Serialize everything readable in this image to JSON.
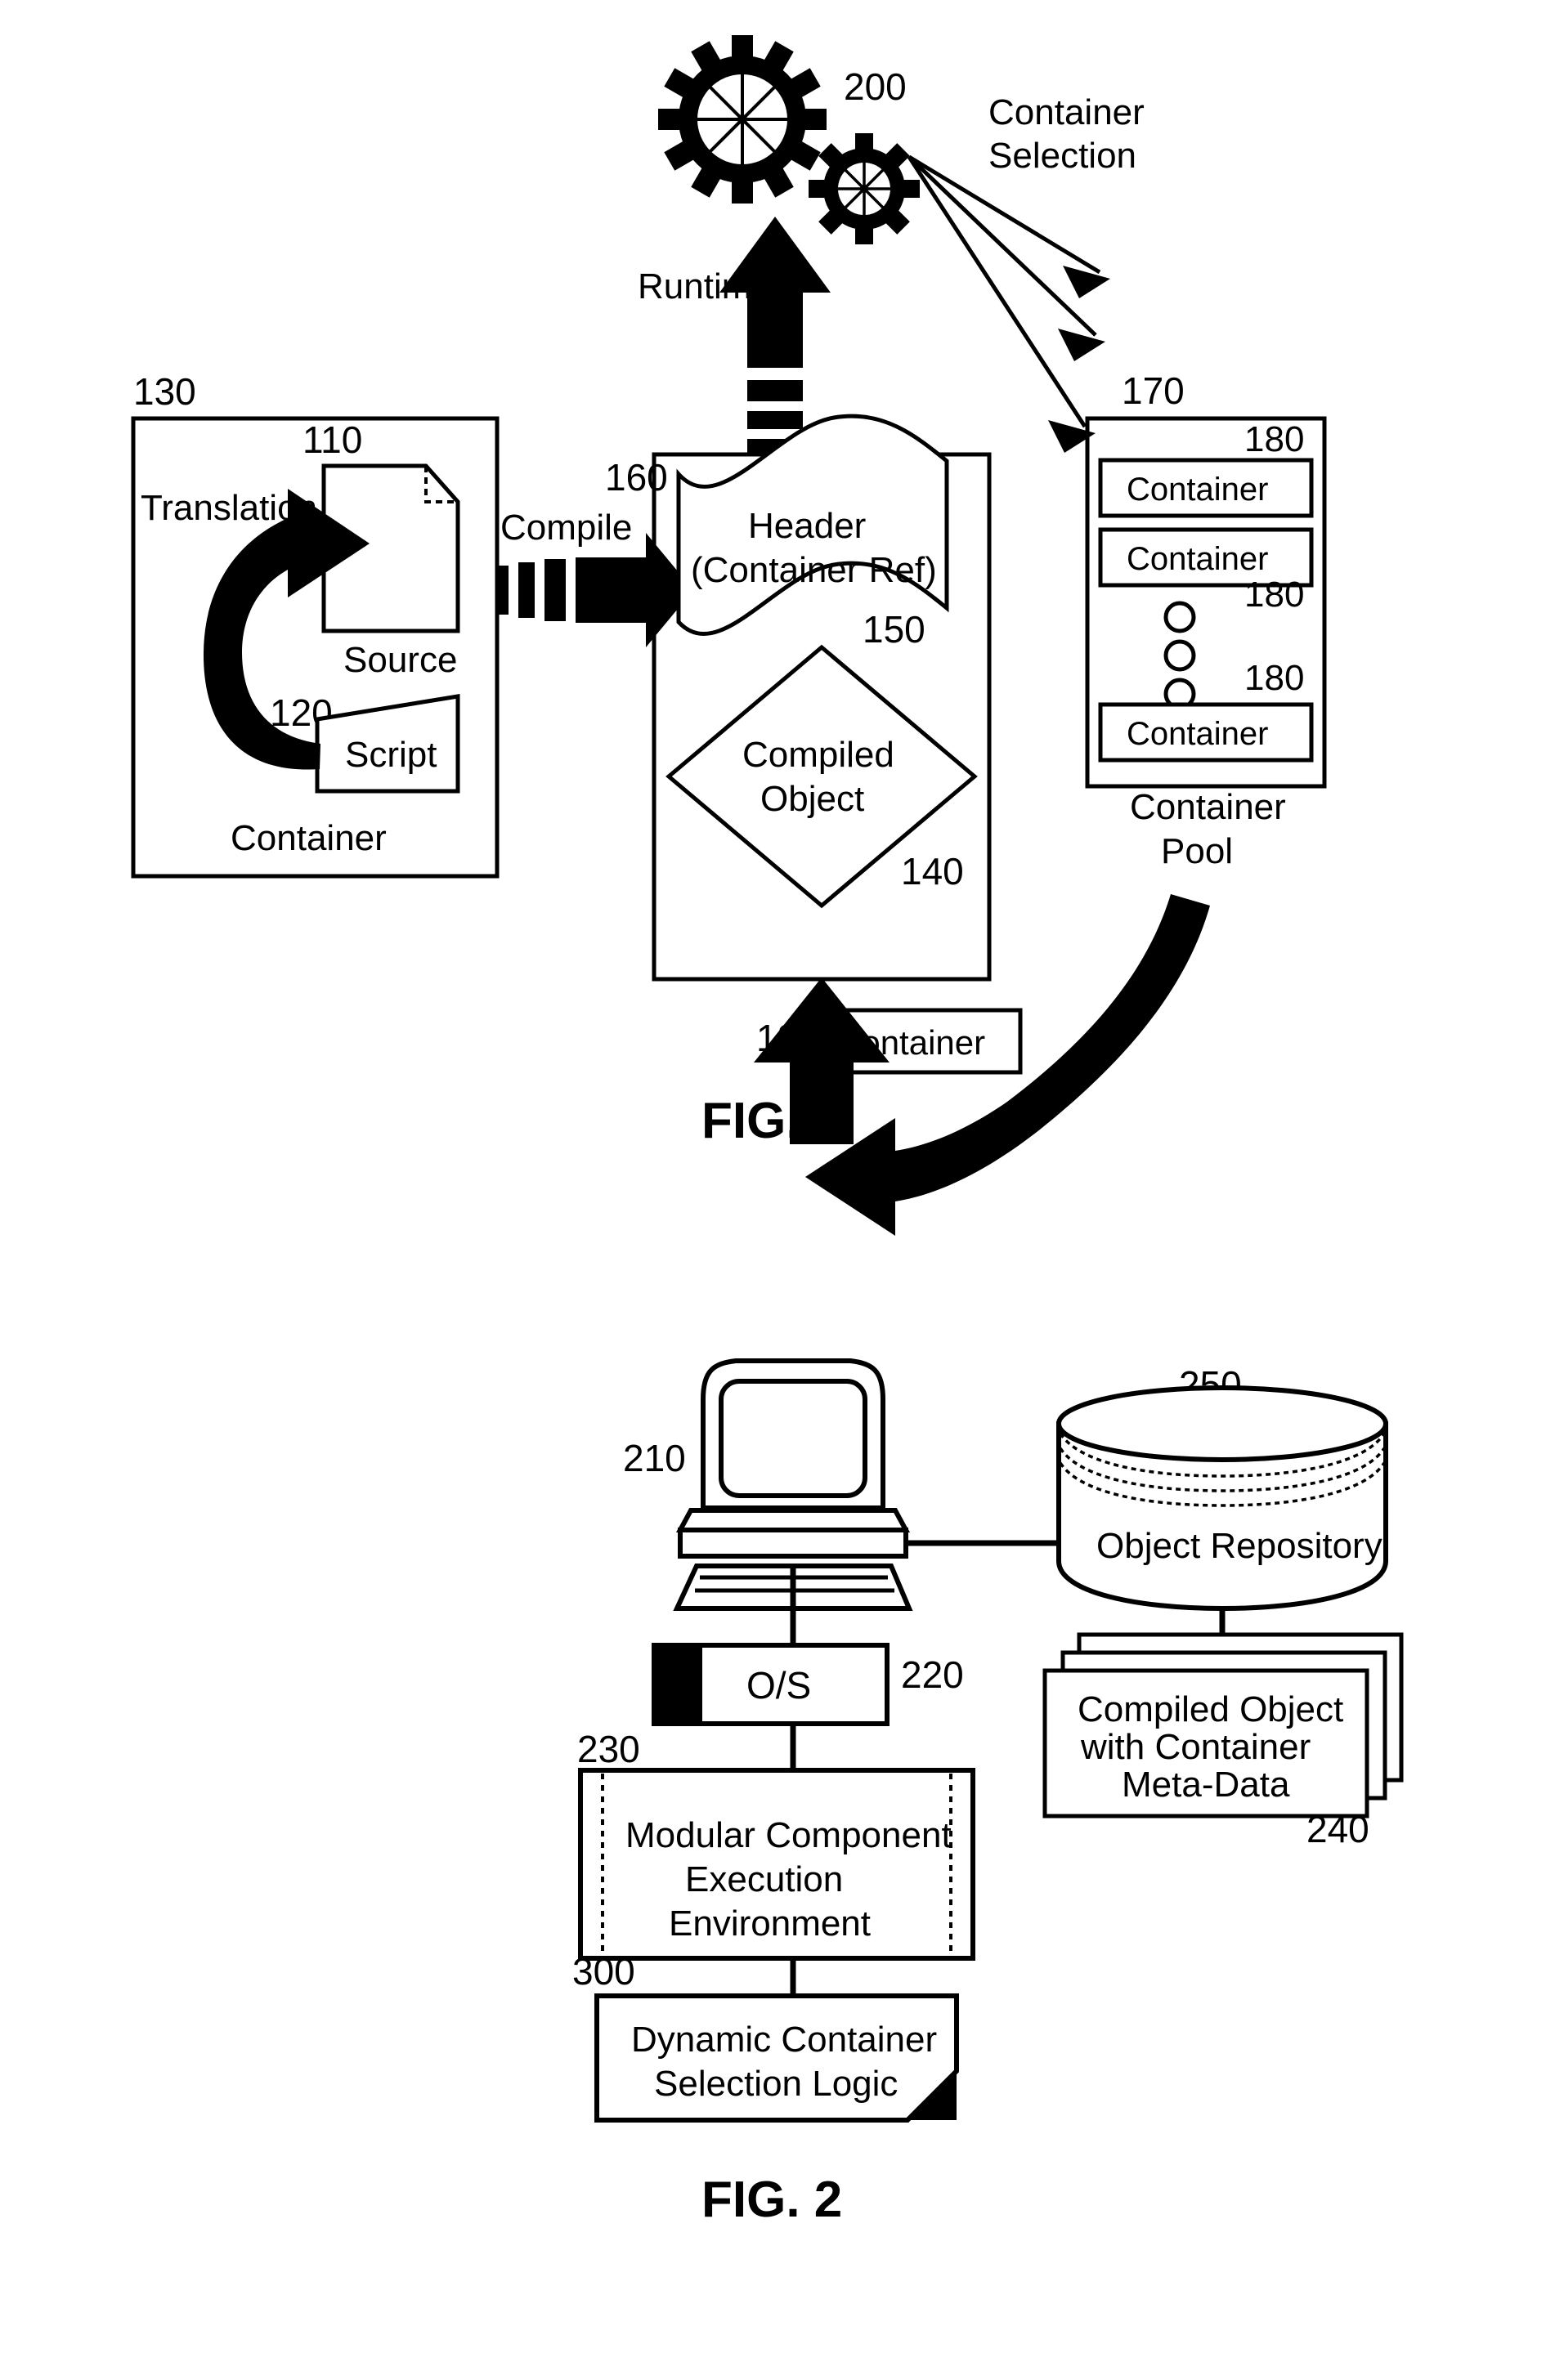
{
  "document": {
    "type": "patent-drawing-sheet",
    "figures": [
      "FIG. 1",
      "FIG. 2"
    ]
  },
  "fig1": {
    "caption": "FIG. 1",
    "gears": {
      "ref": "200",
      "icon": "gears-icon",
      "count": 2
    },
    "runtime_arrow": {
      "label": "Runtime",
      "icon": "up-arrow-dashed-icon"
    },
    "container_selection": {
      "label_line1": "Container",
      "label_line2": "Selection",
      "arrow_count": 3
    },
    "left_container": {
      "ref": "130",
      "label": "Container",
      "translation_label": "Translation",
      "source": {
        "ref": "110",
        "label": "Source",
        "icon": "document-page-icon"
      },
      "script": {
        "ref": "120",
        "label": "Script",
        "icon": "script-sheet-icon"
      }
    },
    "compile_arrow": {
      "label": "Compile",
      "icon": "right-arrow-dashed-icon"
    },
    "object_box": {
      "ref": "160",
      "header": {
        "ref": "150",
        "line1": "Header",
        "line2": "(Container Ref)",
        "icon": "banner-ribbon-icon"
      },
      "compiled_object": {
        "ref": "140",
        "line1": "Compiled",
        "line2": "Object",
        "icon": "diamond-icon"
      }
    },
    "container_pool": {
      "ref": "170",
      "label_line1": "Container",
      "label_line2": "Pool",
      "item_ref": "180",
      "items": [
        {
          "ref": "180",
          "label": "Container"
        },
        {
          "ref": "180",
          "label": "Container"
        },
        {
          "ref": "180",
          "label": "Container"
        }
      ],
      "ellipsis_icon": "vertical-dots-icon",
      "ellipsis_count": 3
    },
    "bottom_container": {
      "ref": "180",
      "label": "Container"
    }
  },
  "fig2": {
    "caption": "FIG. 2",
    "computer": {
      "ref": "210",
      "icon": "desktop-computer-icon"
    },
    "os": {
      "ref": "220",
      "label": "O/S"
    },
    "execution_environment": {
      "ref": "230",
      "line1": "Modular Component",
      "line2": "Execution",
      "line3": "Environment"
    },
    "selection_logic": {
      "ref": "300",
      "line1": "Dynamic Container",
      "line2": "Selection Logic"
    },
    "object_repository": {
      "ref": "250",
      "label": "Object Repository",
      "icon": "database-cylinder-icon"
    },
    "compiled_objects": {
      "ref": "240",
      "line1": "Compiled Object",
      "line2": "with Container",
      "line3": "Meta-Data",
      "icon": "stacked-pages-icon",
      "stack_count": 3
    }
  },
  "style": {
    "ink": "#000000",
    "paper": "#ffffff"
  }
}
